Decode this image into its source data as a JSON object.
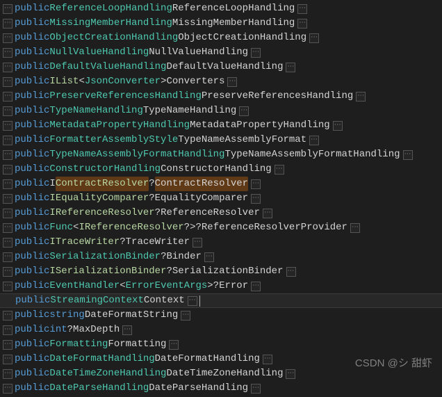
{
  "watermark": "CSDN @シ 甜虾",
  "kw_public": "public",
  "lines": [
    {
      "seg": [
        [
          "kw",
          "public"
        ],
        [
          "",
          true
        ],
        [
          "type",
          "ReferenceLoopHandling"
        ],
        [
          "",
          true
        ],
        [
          "ident",
          "ReferenceLoopHandling"
        ]
      ],
      "folds": [
        true,
        true
      ]
    },
    {
      "seg": [
        [
          "kw",
          "public"
        ],
        [
          "",
          true
        ],
        [
          "type",
          "MissingMemberHandling"
        ],
        [
          "",
          true
        ],
        [
          "ident",
          "MissingMemberHandling"
        ]
      ],
      "folds": [
        true,
        true
      ]
    },
    {
      "seg": [
        [
          "kw",
          "public"
        ],
        [
          "",
          true
        ],
        [
          "type",
          "ObjectCreationHandling"
        ],
        [
          "",
          true
        ],
        [
          "ident",
          "ObjectCreationHandling"
        ]
      ],
      "folds": [
        true,
        true
      ]
    },
    {
      "seg": [
        [
          "kw",
          "public"
        ],
        [
          "",
          true
        ],
        [
          "type",
          "NullValueHandling"
        ],
        [
          "",
          true
        ],
        [
          "ident",
          "NullValueHandling"
        ]
      ],
      "folds": [
        true,
        true
      ]
    },
    {
      "seg": [
        [
          "kw",
          "public"
        ],
        [
          "",
          true
        ],
        [
          "type",
          "DefaultValueHandling"
        ],
        [
          "",
          true
        ],
        [
          "ident",
          "DefaultValueHandling"
        ]
      ],
      "folds": [
        true,
        true
      ]
    },
    {
      "seg": [
        [
          "kw",
          "public"
        ],
        [
          "",
          true
        ],
        [
          "iface",
          "IList"
        ],
        [
          "punct",
          "<"
        ],
        [
          "type",
          "JsonConverter"
        ],
        [
          "punct",
          ">"
        ],
        [
          "",
          true
        ],
        [
          "ident",
          "Converters"
        ]
      ],
      "folds": [
        true,
        true
      ]
    },
    {
      "seg": [
        [
          "kw",
          "public"
        ],
        [
          "",
          true
        ],
        [
          "type",
          "PreserveReferencesHandling"
        ],
        [
          "",
          true
        ],
        [
          "ident",
          "PreserveReferencesHandling"
        ]
      ],
      "folds": [
        true,
        true
      ]
    },
    {
      "seg": [
        [
          "kw",
          "public"
        ],
        [
          "",
          true
        ],
        [
          "type",
          "TypeNameHandling"
        ],
        [
          "",
          true
        ],
        [
          "ident",
          "TypeNameHandling"
        ]
      ],
      "folds": [
        true,
        true
      ]
    },
    {
      "seg": [
        [
          "kw",
          "public"
        ],
        [
          "",
          true
        ],
        [
          "type",
          "MetadataPropertyHandling"
        ],
        [
          "",
          true
        ],
        [
          "ident",
          "MetadataPropertyHandling"
        ]
      ],
      "folds": [
        true,
        true
      ]
    },
    {
      "seg": [
        [
          "kw",
          "public"
        ],
        [
          "",
          true
        ],
        [
          "type",
          "FormatterAssemblyStyle"
        ],
        [
          "",
          true
        ],
        [
          "ident",
          "TypeNameAssemblyFormat"
        ]
      ],
      "folds": [
        true,
        true
      ]
    },
    {
      "seg": [
        [
          "kw",
          "public"
        ],
        [
          "",
          true
        ],
        [
          "type",
          "TypeNameAssemblyFormatHandling"
        ],
        [
          "",
          true
        ],
        [
          "ident",
          "TypeNameAssemblyFormatHandling"
        ]
      ],
      "folds": [
        true,
        true
      ]
    },
    {
      "seg": [
        [
          "kw",
          "public"
        ],
        [
          "",
          true
        ],
        [
          "type",
          "ConstructorHandling"
        ],
        [
          "",
          true
        ],
        [
          "ident",
          "ConstructorHandling"
        ]
      ],
      "folds": [
        true,
        true
      ]
    },
    {
      "seg": [
        [
          "kw",
          "public"
        ],
        [
          "",
          true
        ],
        [
          "ident",
          "I"
        ],
        [
          "hl-type",
          "ContractResolver"
        ],
        [
          "punct",
          "?"
        ],
        [
          "",
          true
        ],
        [
          "hl-name",
          "ContractResolver"
        ]
      ],
      "folds": [
        true,
        true
      ]
    },
    {
      "seg": [
        [
          "kw",
          "public"
        ],
        [
          "",
          true
        ],
        [
          "iface",
          "IEqualityComparer"
        ],
        [
          "punct",
          "?"
        ],
        [
          "",
          true
        ],
        [
          "ident",
          "EqualityComparer"
        ]
      ],
      "folds": [
        true,
        true
      ]
    },
    {
      "seg": [
        [
          "kw",
          "public"
        ],
        [
          "",
          true
        ],
        [
          "iface",
          "IReferenceResolver"
        ],
        [
          "punct",
          "?"
        ],
        [
          "",
          true
        ],
        [
          "ident",
          "ReferenceResolver"
        ]
      ],
      "folds": [
        true,
        true
      ]
    },
    {
      "seg": [
        [
          "kw",
          "public"
        ],
        [
          "",
          true
        ],
        [
          "type",
          "Func"
        ],
        [
          "punct",
          "<"
        ],
        [
          "iface",
          "IReferenceResolver"
        ],
        [
          "punct",
          "?>?"
        ],
        [
          "",
          true
        ],
        [
          "ident",
          "ReferenceResolverProvider"
        ]
      ],
      "folds": [
        true,
        true
      ]
    },
    {
      "seg": [
        [
          "kw",
          "public"
        ],
        [
          "",
          true
        ],
        [
          "iface",
          "ITraceWriter"
        ],
        [
          "punct",
          "?"
        ],
        [
          "",
          true
        ],
        [
          "ident",
          "TraceWriter"
        ]
      ],
      "folds": [
        true,
        true
      ]
    },
    {
      "seg": [
        [
          "kw",
          "public"
        ],
        [
          "",
          true
        ],
        [
          "type",
          "SerializationBinder"
        ],
        [
          "punct",
          "?"
        ],
        [
          "",
          true
        ],
        [
          "ident",
          "Binder"
        ]
      ],
      "folds": [
        true,
        true
      ]
    },
    {
      "seg": [
        [
          "kw",
          "public"
        ],
        [
          "",
          true
        ],
        [
          "iface",
          "ISerializationBinder"
        ],
        [
          "punct",
          "?"
        ],
        [
          "",
          true
        ],
        [
          "ident",
          "SerializationBinder"
        ]
      ],
      "folds": [
        true,
        true
      ]
    },
    {
      "seg": [
        [
          "kw",
          "public"
        ],
        [
          "",
          true
        ],
        [
          "type",
          "EventHandler"
        ],
        [
          "punct",
          "<"
        ],
        [
          "type",
          "ErrorEventArgs"
        ],
        [
          "punct",
          ">?"
        ],
        [
          "",
          true
        ],
        [
          "ident",
          "Error"
        ]
      ],
      "folds": [
        true,
        true
      ]
    },
    {
      "seg": [
        [
          "kw",
          "public"
        ],
        [
          "",
          true
        ],
        [
          "type",
          "StreamingContext"
        ],
        [
          "",
          true
        ],
        [
          "ident",
          "Context"
        ]
      ],
      "folds": [
        false,
        true
      ],
      "current": true,
      "cursor": true
    },
    {
      "seg": [
        [
          "kw",
          "public"
        ],
        [
          "",
          true
        ],
        [
          "kw",
          "string"
        ],
        [
          "",
          true
        ],
        [
          "ident",
          "DateFormatString"
        ]
      ],
      "folds": [
        true,
        true
      ]
    },
    {
      "seg": [
        [
          "kw",
          "public"
        ],
        [
          "",
          true
        ],
        [
          "kw",
          "int"
        ],
        [
          "punct",
          "?"
        ],
        [
          "",
          true
        ],
        [
          "ident",
          "MaxDepth"
        ]
      ],
      "folds": [
        true,
        true
      ]
    },
    {
      "seg": [
        [
          "kw",
          "public"
        ],
        [
          "",
          true
        ],
        [
          "type",
          "Formatting"
        ],
        [
          "",
          true
        ],
        [
          "ident",
          "Formatting"
        ]
      ],
      "folds": [
        true,
        true
      ]
    },
    {
      "seg": [
        [
          "kw",
          "public"
        ],
        [
          "",
          true
        ],
        [
          "type",
          "DateFormatHandling"
        ],
        [
          "",
          true
        ],
        [
          "ident",
          "DateFormatHandling"
        ]
      ],
      "folds": [
        true,
        true
      ]
    },
    {
      "seg": [
        [
          "kw",
          "public"
        ],
        [
          "",
          true
        ],
        [
          "type",
          "DateTimeZoneHandling"
        ],
        [
          "",
          true
        ],
        [
          "ident",
          "DateTimeZoneHandling"
        ]
      ],
      "folds": [
        true,
        true
      ]
    },
    {
      "seg": [
        [
          "kw",
          "public"
        ],
        [
          "",
          true
        ],
        [
          "type",
          "DateParseHandling"
        ],
        [
          "",
          true
        ],
        [
          "ident",
          "DateParseHandling"
        ]
      ],
      "folds": [
        true,
        true
      ]
    }
  ]
}
